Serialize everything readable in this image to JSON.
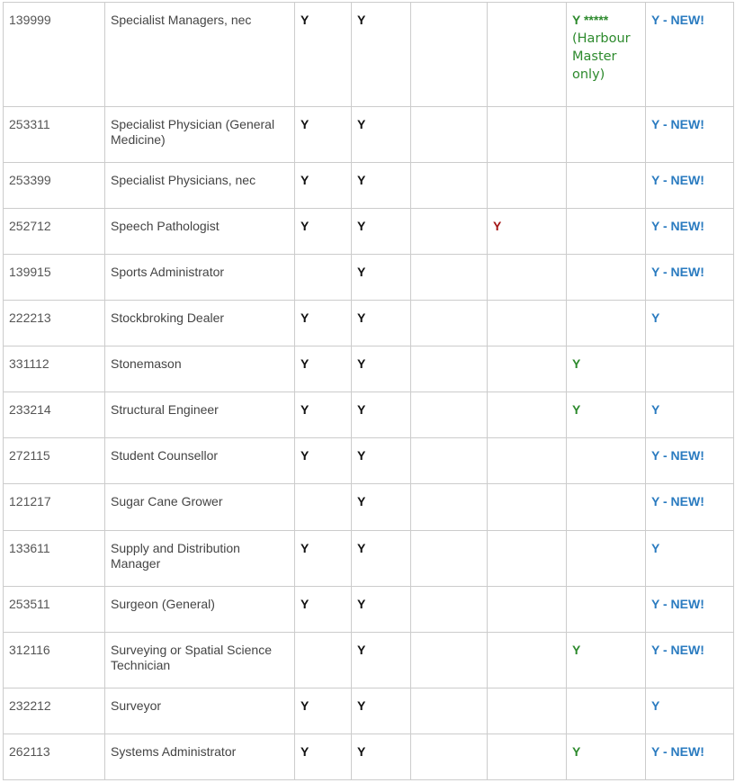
{
  "colors": {
    "mark_black": "#111111",
    "mark_red": "#a31515",
    "mark_green": "#2d8a2d",
    "mark_blue": "#2a7bc0",
    "text_grey": "#444444",
    "border": "#cccccc"
  },
  "rows": [
    {
      "code": "139999",
      "name": "Specialist Managers, nec",
      "c1": "Y",
      "c2": "Y",
      "c3": "",
      "c4": "",
      "c5_lead": "Y *****",
      "c5_note": "(Harbour Master only)",
      "c6": "Y - NEW!"
    },
    {
      "code": "253311",
      "name": "Specialist Physician (General Medicine)",
      "c1": "Y",
      "c2": "Y",
      "c3": "",
      "c4": "",
      "c5": "",
      "c6": "Y - NEW!"
    },
    {
      "code": "253399",
      "name": "Specialist Physicians, nec",
      "c1": "Y",
      "c2": "Y",
      "c3": "",
      "c4": "",
      "c5": "",
      "c6": "Y - NEW!"
    },
    {
      "code": "252712",
      "name": "Speech Pathologist",
      "c1": "Y",
      "c2": "Y",
      "c3": "",
      "c4": "Y",
      "c5": "",
      "c6": "Y - NEW!"
    },
    {
      "code": "139915",
      "name": "Sports Administrator",
      "c1": "",
      "c2": "Y",
      "c3": "",
      "c4": "",
      "c5": "",
      "c6": "Y - NEW!"
    },
    {
      "code": "222213",
      "name": "Stockbroking Dealer",
      "c1": "Y",
      "c2": "Y",
      "c3": "",
      "c4": "",
      "c5": "",
      "c6": "Y"
    },
    {
      "code": "331112",
      "name": "Stonemason",
      "c1": "Y",
      "c2": "Y",
      "c3": "",
      "c4": "",
      "c5": "Y",
      "c6": ""
    },
    {
      "code": "233214",
      "name": "Structural Engineer",
      "c1": "Y",
      "c2": "Y",
      "c3": "",
      "c4": "",
      "c5": "Y",
      "c6": "Y"
    },
    {
      "code": "272115",
      "name": "Student Counsellor",
      "c1": "Y",
      "c2": "Y",
      "c3": "",
      "c4": "",
      "c5": "",
      "c6": "Y - NEW!"
    },
    {
      "code": "121217",
      "name": "Sugar Cane Grower",
      "c1": "",
      "c2": "Y",
      "c3": "",
      "c4": "",
      "c5": "",
      "c6": "Y - NEW!"
    },
    {
      "code": "133611",
      "name": "Supply and Distribution Manager",
      "c1": "Y",
      "c2": "Y",
      "c3": "",
      "c4": "",
      "c5": "",
      "c6": "Y"
    },
    {
      "code": "253511",
      "name": "Surgeon (General)",
      "c1": "Y",
      "c2": "Y",
      "c3": "",
      "c4": "",
      "c5": "",
      "c6": "Y - NEW!"
    },
    {
      "code": "312116",
      "name": "Surveying or Spatial Science Technician",
      "c1": "",
      "c2": "Y",
      "c3": "",
      "c4": "",
      "c5": "Y",
      "c6": "Y - NEW!"
    },
    {
      "code": "232212",
      "name": "Surveyor",
      "c1": "Y",
      "c2": "Y",
      "c3": "",
      "c4": "",
      "c5": "",
      "c6": "Y"
    },
    {
      "code": "262113",
      "name": "Systems Administrator",
      "c1": "Y",
      "c2": "Y",
      "c3": "",
      "c4": "",
      "c5": "Y",
      "c6": "Y - NEW!"
    }
  ]
}
